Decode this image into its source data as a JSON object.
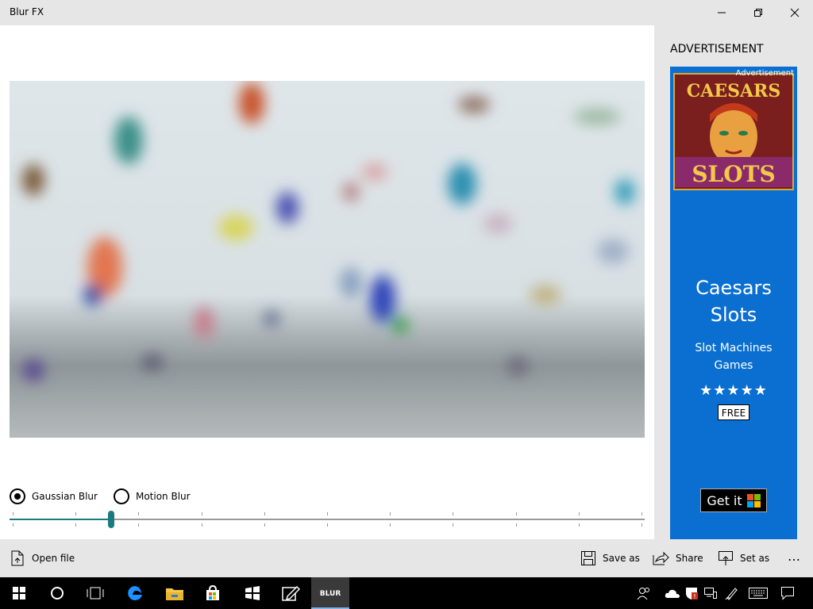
{
  "window": {
    "title": "Blur FX",
    "controls": [
      "minimize",
      "maximize",
      "close"
    ]
  },
  "editor": {
    "blur_options": [
      {
        "label": "Gaussian Blur",
        "selected": true
      },
      {
        "label": "Motion Blur",
        "selected": false
      }
    ],
    "slider": {
      "value_fraction": 0.16,
      "ticks": 11
    },
    "accent_color": "#1a7a80"
  },
  "advertisement": {
    "heading": "ADVERTISEMENT",
    "small_label": "Advertisement",
    "logo_text_top": "CAESARS",
    "logo_text_bottom": "SLOTS",
    "title": "Caesars Slots",
    "subtitle": "Slot Machines Games",
    "rating_stars": "★★★★★",
    "price_badge": "FREE",
    "cta": "Get it",
    "card_color": "#0a6fd0"
  },
  "command_bar": {
    "open_file": "Open file",
    "save_as": "Save as",
    "share": "Share",
    "set_as": "Set as",
    "more": "…"
  },
  "taskbar": {
    "apps": [
      "start-icon",
      "cortana-icon",
      "task-view-icon",
      "edge-icon",
      "file-explorer-icon",
      "store-icon",
      "unknown-app-icon",
      "sketch-icon",
      "blur-fx-app-icon"
    ],
    "active_app_label": "BLUR",
    "tray": [
      "people-icon",
      "onedrive-icon",
      "defender-icon",
      "network-icon",
      "pen-icon",
      "keyboard-icon",
      "notification-icon"
    ]
  }
}
